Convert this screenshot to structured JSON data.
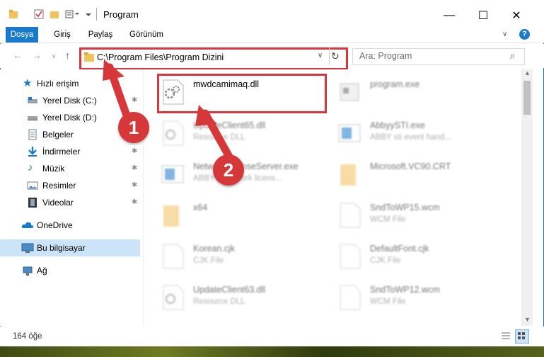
{
  "window": {
    "title": "Program"
  },
  "ribbon": {
    "tabs": [
      "Dosya",
      "Giriş",
      "Paylaş",
      "Görünüm"
    ]
  },
  "address": {
    "path": "C:\\Program Files\\Program Dizini",
    "search_placeholder": "Ara: Program"
  },
  "sidebar": {
    "items": [
      {
        "label": "Hızlı erişim",
        "icon": "star-icon"
      },
      {
        "label": "Yerel Disk (C:)",
        "icon": "drive-icon"
      },
      {
        "label": "Yerel Disk (D:)",
        "icon": "drive-icon"
      },
      {
        "label": "Belgeler",
        "icon": "document-icon"
      },
      {
        "label": "İndirmeler",
        "icon": "download-icon"
      },
      {
        "label": "Müzik",
        "icon": "music-icon"
      },
      {
        "label": "Resimler",
        "icon": "pictures-icon"
      },
      {
        "label": "Videolar",
        "icon": "video-icon"
      },
      {
        "label": "OneDrive",
        "icon": "cloud-icon"
      },
      {
        "label": "Bu bilgisayar",
        "icon": "computer-icon"
      },
      {
        "label": "Ağ",
        "icon": "network-icon"
      }
    ]
  },
  "files": [
    {
      "name": "mwdcamimaq.dll",
      "type": ""
    },
    {
      "name": "program.exe",
      "type": ""
    },
    {
      "name": "UpdateClient65.dll",
      "type": "Resource DLL"
    },
    {
      "name": "AbbyySTI.exe",
      "type": "ABBY sti event hand..."
    },
    {
      "name": "NetworkLicenseServer.exe",
      "type": "ABBYY Network licens..."
    },
    {
      "name": "Microsoft.VC90.CRT",
      "type": ""
    },
    {
      "name": "x64",
      "type": ""
    },
    {
      "name": "SndToWP15.wcm",
      "type": "WCM File"
    },
    {
      "name": "Korean.cjk",
      "type": "CJK File"
    },
    {
      "name": "DefaultFont.cjk",
      "type": "CJK File"
    },
    {
      "name": "UpdateClient63.dll",
      "type": "Resource DLL"
    },
    {
      "name": "SndToWP12.wcm",
      "type": "WCM File"
    }
  ],
  "status": {
    "count": "164 öğe"
  },
  "annotations": {
    "badge1": "1",
    "badge2": "2"
  },
  "colors": {
    "accent": "#1979ca",
    "highlight": "#d9363e"
  }
}
